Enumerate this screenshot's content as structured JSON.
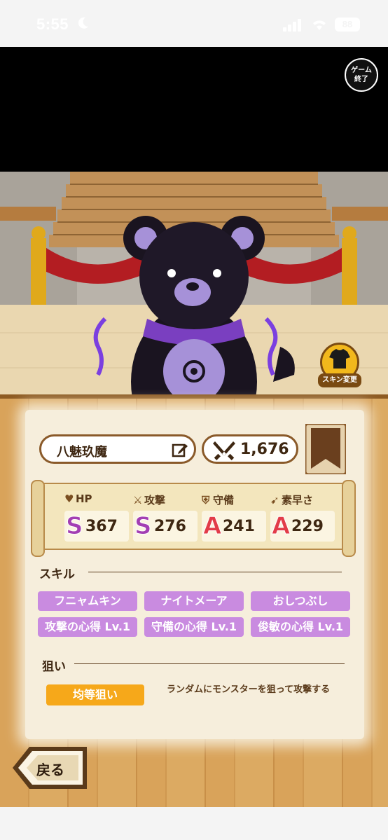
{
  "status_bar": {
    "time": "5:55",
    "battery": "88"
  },
  "game": {
    "exit_button": {
      "line1": "ゲーム",
      "line2": "終了"
    },
    "skin_button_label": "スキン変更"
  },
  "character": {
    "name": "八魅玖魔",
    "power": "1,676"
  },
  "stats": [
    {
      "label": "HP",
      "icon": "heart-icon",
      "rank": "S",
      "value": "367"
    },
    {
      "label": "攻撃",
      "icon": "attack-icon",
      "rank": "S",
      "value": "276"
    },
    {
      "label": "守備",
      "icon": "shield-icon",
      "rank": "A",
      "value": "241"
    },
    {
      "label": "素早さ",
      "icon": "boot-icon",
      "rank": "A",
      "value": "229"
    }
  ],
  "skills": {
    "title": "スキル",
    "items": [
      "フニャムキン",
      "ナイトメーア",
      "おしつぶし",
      "攻撃の心得 Lv.1",
      "守備の心得 Lv.1",
      "俊敏の心得 Lv.1"
    ]
  },
  "target": {
    "title": "狙い",
    "mode": "均等狙い",
    "description": "ランダムにモンスターを狙って攻撃する"
  },
  "back_button": "戻る",
  "colors": {
    "skill": "#c98be0",
    "target": "#f6a81a",
    "rank_s": "#a33fb3",
    "rank_a": "#e23c48"
  }
}
